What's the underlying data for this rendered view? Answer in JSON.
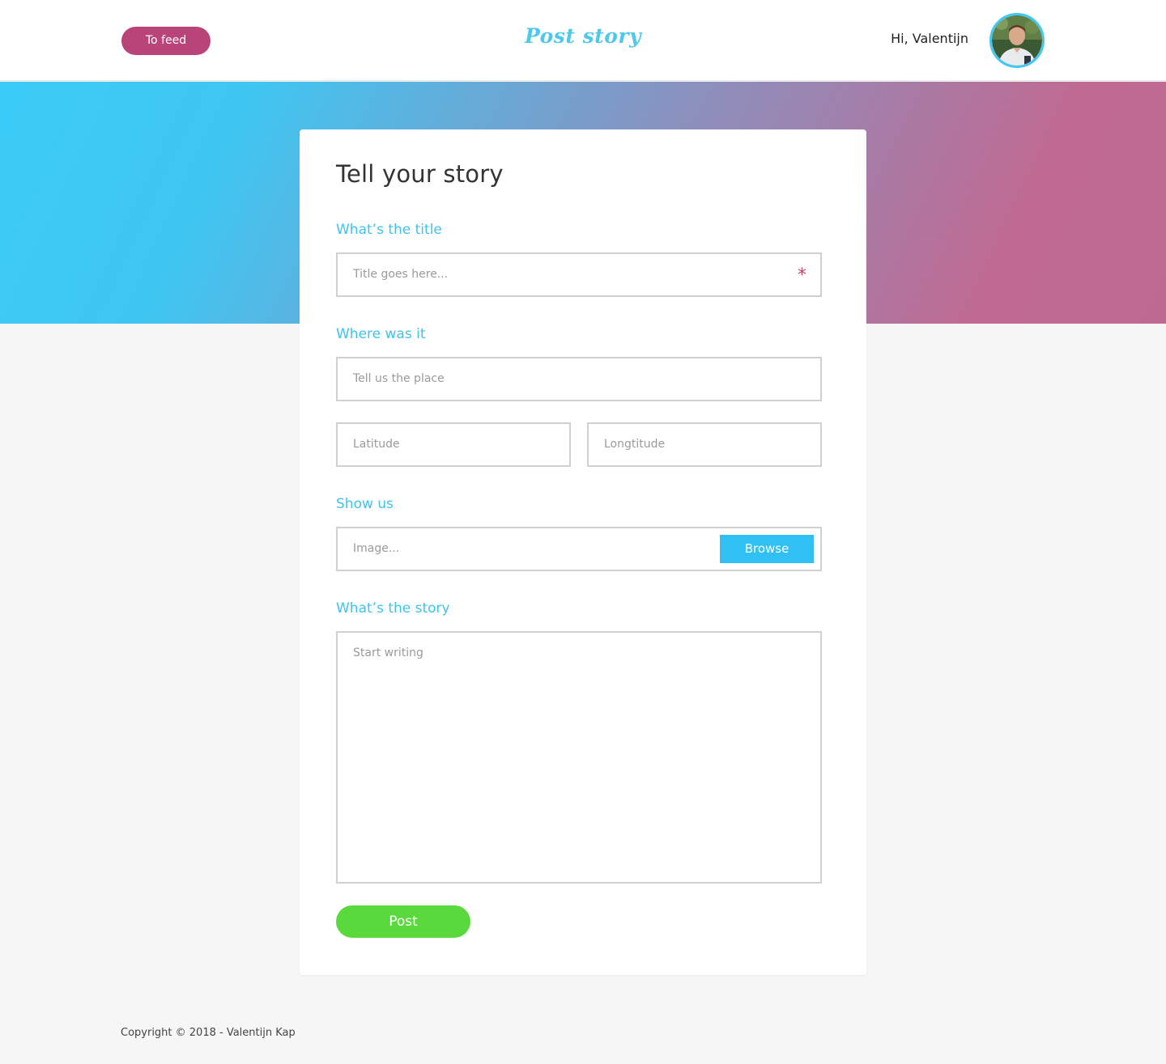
{
  "header": {
    "to_feed_label": "To feed",
    "title": "Post story",
    "greeting": "Hi, Valentijn",
    "avatar_icon": "user-avatar-photo"
  },
  "form": {
    "heading": "Tell your story",
    "title_section": {
      "label": "What’s the title",
      "placeholder": "Title goes here...",
      "required_marker": "*"
    },
    "location_section": {
      "label": "Where was it",
      "place_placeholder": "Tell us the place",
      "latitude_placeholder": "Latitude",
      "longitude_placeholder": "Longtitude"
    },
    "image_section": {
      "label": "Show us",
      "placeholder": "Image...",
      "browse_label": "Browse"
    },
    "story_section": {
      "label": "What’s the story",
      "placeholder": "Start writing"
    },
    "post_label": "Post"
  },
  "footer": {
    "copyright": "Copyright © 2018 - Valentijn Kap"
  },
  "colors": {
    "accent_pink": "#b94479",
    "accent_blue": "#3ec3ee",
    "browse_blue": "#30c0f4",
    "post_green": "#5ad93c",
    "required_red": "#c44762"
  }
}
